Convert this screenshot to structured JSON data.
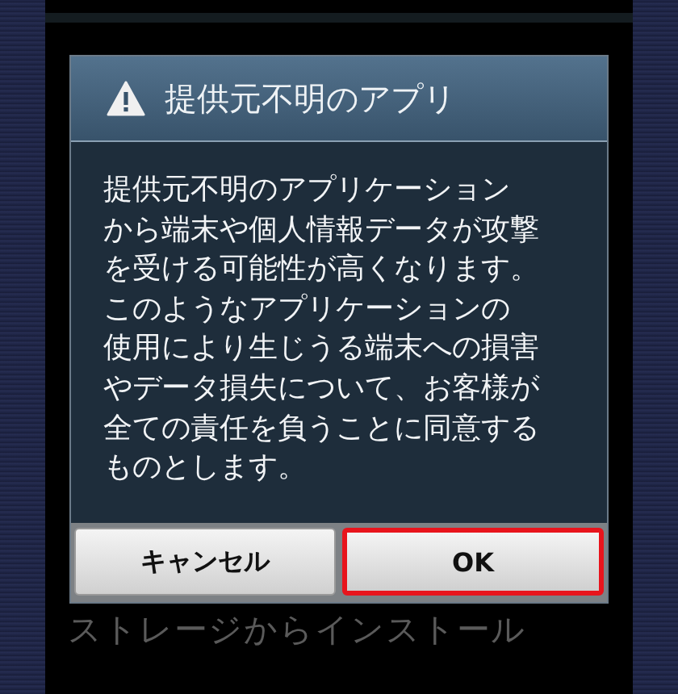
{
  "dialog": {
    "title": "提供元不明のアプリ",
    "message_lines": [
      "提供元不明のアプリケーション",
      "から端末や個人情報データが攻撃",
      "を受ける可能性が高くなります。",
      "このようなアプリケーションの",
      "使用により生じうる端末への損害",
      "やデータ損失について、お客様が",
      "全ての責任を負うことに同意する",
      "ものとします。"
    ],
    "buttons": [
      {
        "label": "キャンセル",
        "highlighted": false
      },
      {
        "label": "OK",
        "highlighted": true
      }
    ]
  },
  "background_item": {
    "label": "ストレージからインストール"
  }
}
